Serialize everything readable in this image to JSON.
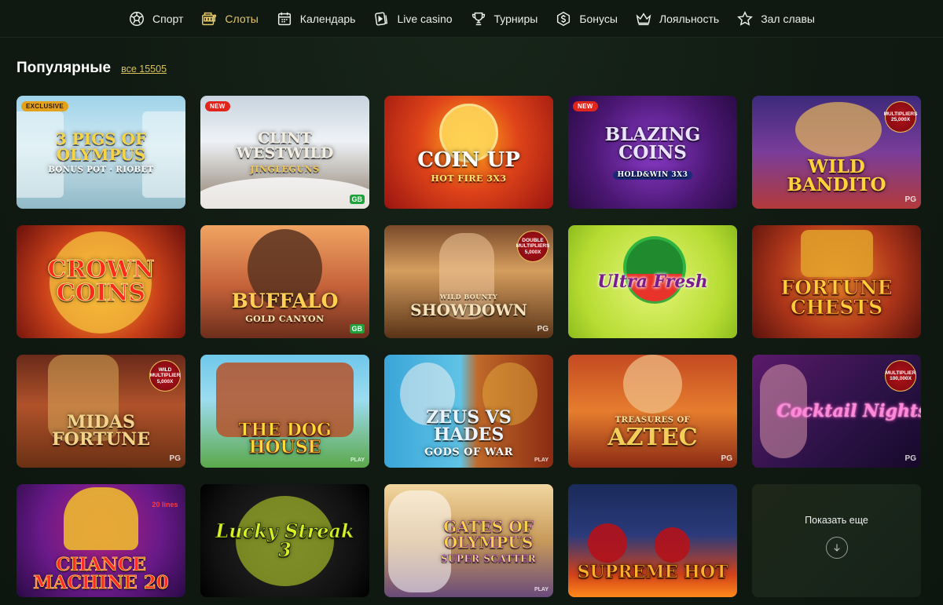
{
  "nav": {
    "items": [
      {
        "label": "Спорт",
        "icon": "soccer-ball-icon",
        "active": false
      },
      {
        "label": "Слоты",
        "icon": "slot-machine-icon",
        "active": true
      },
      {
        "label": "Календарь",
        "icon": "calendar-icon",
        "active": false
      },
      {
        "label": "Live casino",
        "icon": "live-casino-icon",
        "active": false
      },
      {
        "label": "Турниры",
        "icon": "trophy-icon",
        "active": false
      },
      {
        "label": "Бонусы",
        "icon": "dollar-coin-icon",
        "active": false
      },
      {
        "label": "Лояльность",
        "icon": "crown-icon",
        "active": false
      },
      {
        "label": "Зал славы",
        "icon": "star-icon",
        "active": false
      }
    ],
    "active_color": "#e6c96a"
  },
  "section": {
    "title": "Популярные",
    "all_link": "все 15505"
  },
  "games": [
    {
      "title": "3 Pigs of Olympus",
      "sub": "Bonus Pot · Riobet",
      "badge": "EXCLUSIVE",
      "provider": "",
      "multiplier": ""
    },
    {
      "title": "Clint Westwild",
      "sub": "Jingleguns",
      "badge": "NEW",
      "provider": "GB",
      "multiplier": ""
    },
    {
      "title": "Coin Up",
      "sub": "Hot Fire 3x3",
      "badge": "",
      "provider": "",
      "multiplier": ""
    },
    {
      "title": "Blazing Coins",
      "sub": "Hold&Win 3x3",
      "badge": "NEW",
      "provider": "",
      "multiplier": ""
    },
    {
      "title": "Wild Bandito",
      "sub": "",
      "badge": "",
      "provider": "PG",
      "multiplier": "MULTIPLIERS 25,000X"
    },
    {
      "title": "Crown Coins",
      "sub": "",
      "badge": "",
      "provider": "",
      "multiplier": ""
    },
    {
      "title": "Buffalo",
      "sub": "Gold Canyon",
      "badge": "",
      "provider": "GB",
      "multiplier": ""
    },
    {
      "title": "Showdown",
      "sub": "Wild Bounty",
      "badge": "",
      "provider": "PG",
      "multiplier": "DOUBLE MULTIPLIERS 5,000X"
    },
    {
      "title": "Ultra Fresh",
      "sub": "",
      "badge": "",
      "provider": "",
      "multiplier": ""
    },
    {
      "title": "Fortune Chests",
      "sub": "",
      "badge": "",
      "provider": "",
      "multiplier": ""
    },
    {
      "title": "Midas Fortune",
      "sub": "",
      "badge": "",
      "provider": "PG",
      "multiplier": "WILD MULTIPLIER 5,000X"
    },
    {
      "title": "The Dog House",
      "sub": "",
      "badge": "",
      "provider": "PLAY",
      "multiplier": ""
    },
    {
      "title": "Zeus vs Hades",
      "sub": "Gods of War",
      "badge": "",
      "provider": "PLAY",
      "multiplier": ""
    },
    {
      "title": "Aztec",
      "sub": "Treasures of",
      "badge": "",
      "provider": "PG",
      "multiplier": ""
    },
    {
      "title": "Cocktail Nights",
      "sub": "",
      "badge": "",
      "provider": "PG",
      "multiplier": "MULTIPLIER 100,000X"
    },
    {
      "title": "Chance Machine 20",
      "sub": "",
      "badge": "",
      "provider": "",
      "multiplier": "20 lines"
    },
    {
      "title": "Lucky Streak 3",
      "sub": "",
      "badge": "",
      "provider": "",
      "multiplier": ""
    },
    {
      "title": "Gates of Olympus",
      "sub": "Super Scatter",
      "badge": "",
      "provider": "PLAY",
      "multiplier": ""
    },
    {
      "title": "Supreme Hot",
      "sub": "",
      "badge": "",
      "provider": "",
      "multiplier": ""
    }
  ],
  "show_more": {
    "label": "Показать еще"
  }
}
